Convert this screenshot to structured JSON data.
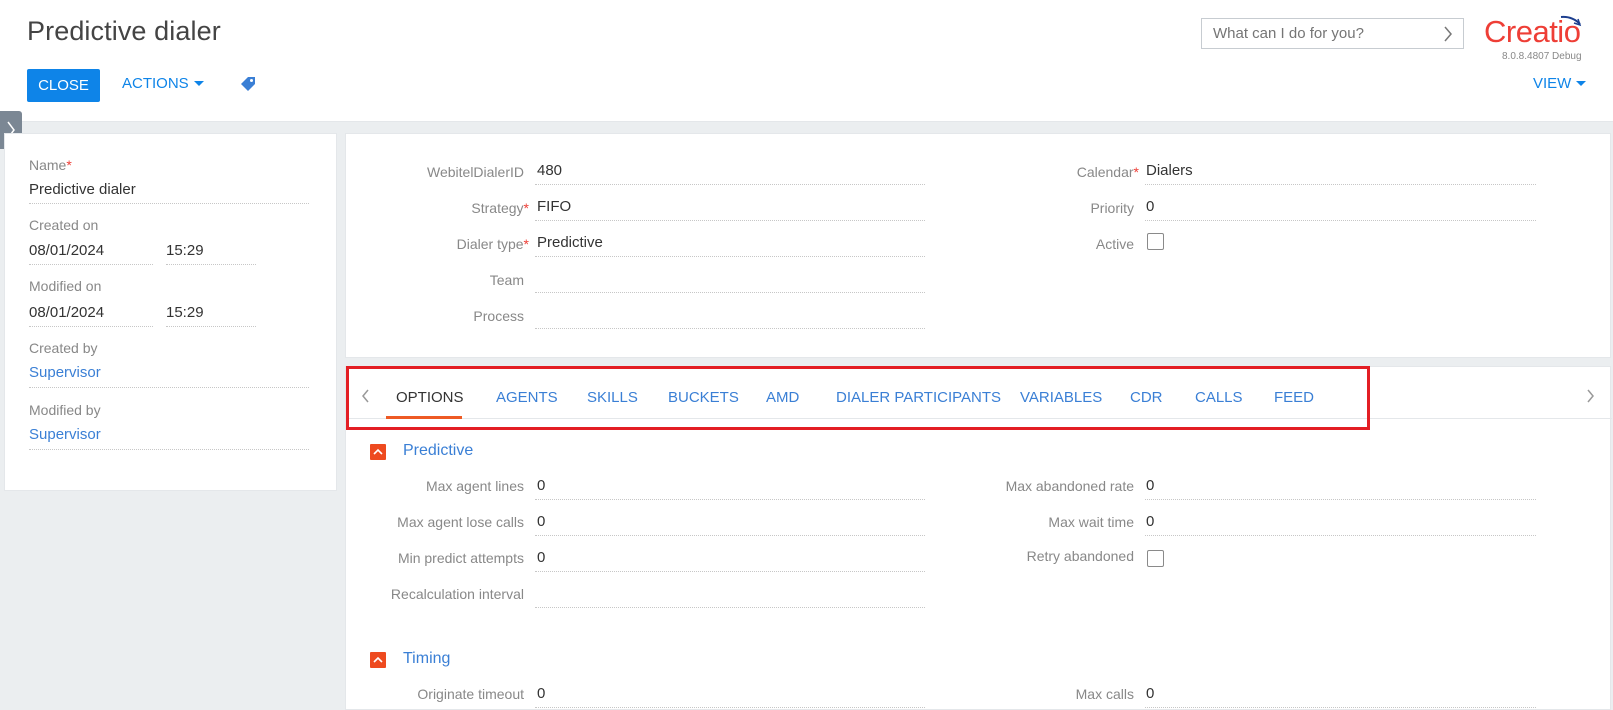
{
  "header": {
    "title": "Predictive dialer",
    "close_label": "CLOSE",
    "actions_label": "ACTIONS",
    "search_placeholder": "What can I do for you?",
    "logo_text": "Creatio",
    "version": "8.0.8.4807 Debug",
    "view_label": "VIEW"
  },
  "left_panel": {
    "name_label": "Name",
    "name_value": "Predictive dialer",
    "created_on_label": "Created on",
    "created_on_date": "08/01/2024",
    "created_on_time": "15:29",
    "modified_on_label": "Modified on",
    "modified_on_date": "08/01/2024",
    "modified_on_time": "15:29",
    "created_by_label": "Created by",
    "created_by_value": "Supervisor",
    "modified_by_label": "Modified by",
    "modified_by_value": "Supervisor"
  },
  "main": {
    "webitel_label": "WebitelDialerID",
    "webitel_value": "480",
    "strategy_label": "Strategy",
    "strategy_value": "FIFO",
    "dialer_type_label": "Dialer type",
    "dialer_type_value": "Predictive",
    "team_label": "Team",
    "team_value": "",
    "process_label": "Process",
    "process_value": "",
    "calendar_label": "Calendar",
    "calendar_value": "Dialers",
    "priority_label": "Priority",
    "priority_value": "0",
    "active_label": "Active",
    "active_checked": false
  },
  "tabs": [
    {
      "label": "OPTIONS",
      "active": true
    },
    {
      "label": "AGENTS"
    },
    {
      "label": "SKILLS"
    },
    {
      "label": "BUCKETS"
    },
    {
      "label": "AMD"
    },
    {
      "label": "DIALER PARTICIPANTS"
    },
    {
      "label": "VARIABLES"
    },
    {
      "label": "CDR"
    },
    {
      "label": "CALLS"
    },
    {
      "label": "FEED"
    }
  ],
  "predictive": {
    "title": "Predictive",
    "max_agent_lines_label": "Max agent lines",
    "max_agent_lines_value": "0",
    "max_agent_lose_calls_label": "Max agent lose calls",
    "max_agent_lose_calls_value": "0",
    "min_predict_attempts_label": "Min predict attempts",
    "min_predict_attempts_value": "0",
    "recalculation_interval_label": "Recalculation interval",
    "recalculation_interval_value": "",
    "max_abandoned_rate_label": "Max abandoned rate",
    "max_abandoned_rate_value": "0",
    "max_wait_time_label": "Max wait time",
    "max_wait_time_value": "0",
    "retry_abandoned_label": "Retry abandoned",
    "retry_abandoned_checked": false
  },
  "timing": {
    "title": "Timing",
    "originate_timeout_label": "Originate timeout",
    "originate_timeout_value": "0",
    "max_calls_label": "Max calls",
    "max_calls_value": "0"
  },
  "colors": {
    "accent": "#0e84e8",
    "brand": "#ee3e36",
    "link": "#3a7fd5",
    "highlight": "#e31e24"
  }
}
